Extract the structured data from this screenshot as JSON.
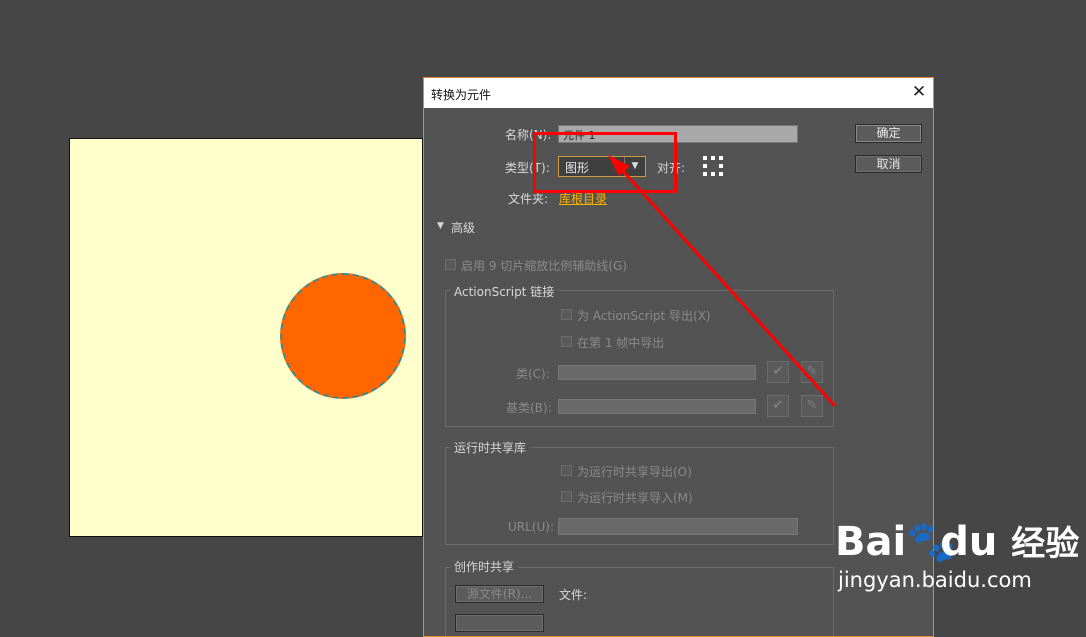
{
  "dialog": {
    "title": "转换为元件",
    "name_label": "名称(N):",
    "name_value": "元件 1",
    "type_label": "类型(T):",
    "type_value": "图形",
    "align_label": "对齐:",
    "folder_label": "文件夹:",
    "folder_link": "库根目录",
    "ok_label": "确定",
    "cancel_label": "取消",
    "advanced_label": "高级",
    "enable_9slice": "启用  9 切片缩放比例辅助线(G)",
    "actionscript": {
      "title": "ActionScript 链接",
      "export_as": "为 ActionScript 导出(X)",
      "export_frame1": "在第  1 帧中导出",
      "class_label": "类(C):",
      "base_class_label": "基类(B):"
    },
    "runtime_sharing": {
      "title": "运行时共享库",
      "export_runtime": "为运行时共享导出(O)",
      "import_runtime": "为运行时共享导入(M)",
      "url_label": "URL(U):"
    },
    "authortime_sharing": {
      "title": "创作时共享",
      "source_button": "源文件(R)...",
      "file_label": "文件:"
    }
  },
  "stage": {
    "background": "#ffffcc",
    "circle_color": "#ff6600"
  },
  "annotation": {
    "color": "#ff0000"
  },
  "watermark": {
    "brand": "Bai",
    "brand_suffix": "du",
    "product": "经验",
    "url": "jingyan.baidu.com"
  },
  "icons": [
    "close-icon",
    "chevron-down-icon",
    "checkmark-icon",
    "pencil-icon",
    "registration-grid-icon",
    "triangle-down-icon",
    "paw-icon"
  ]
}
